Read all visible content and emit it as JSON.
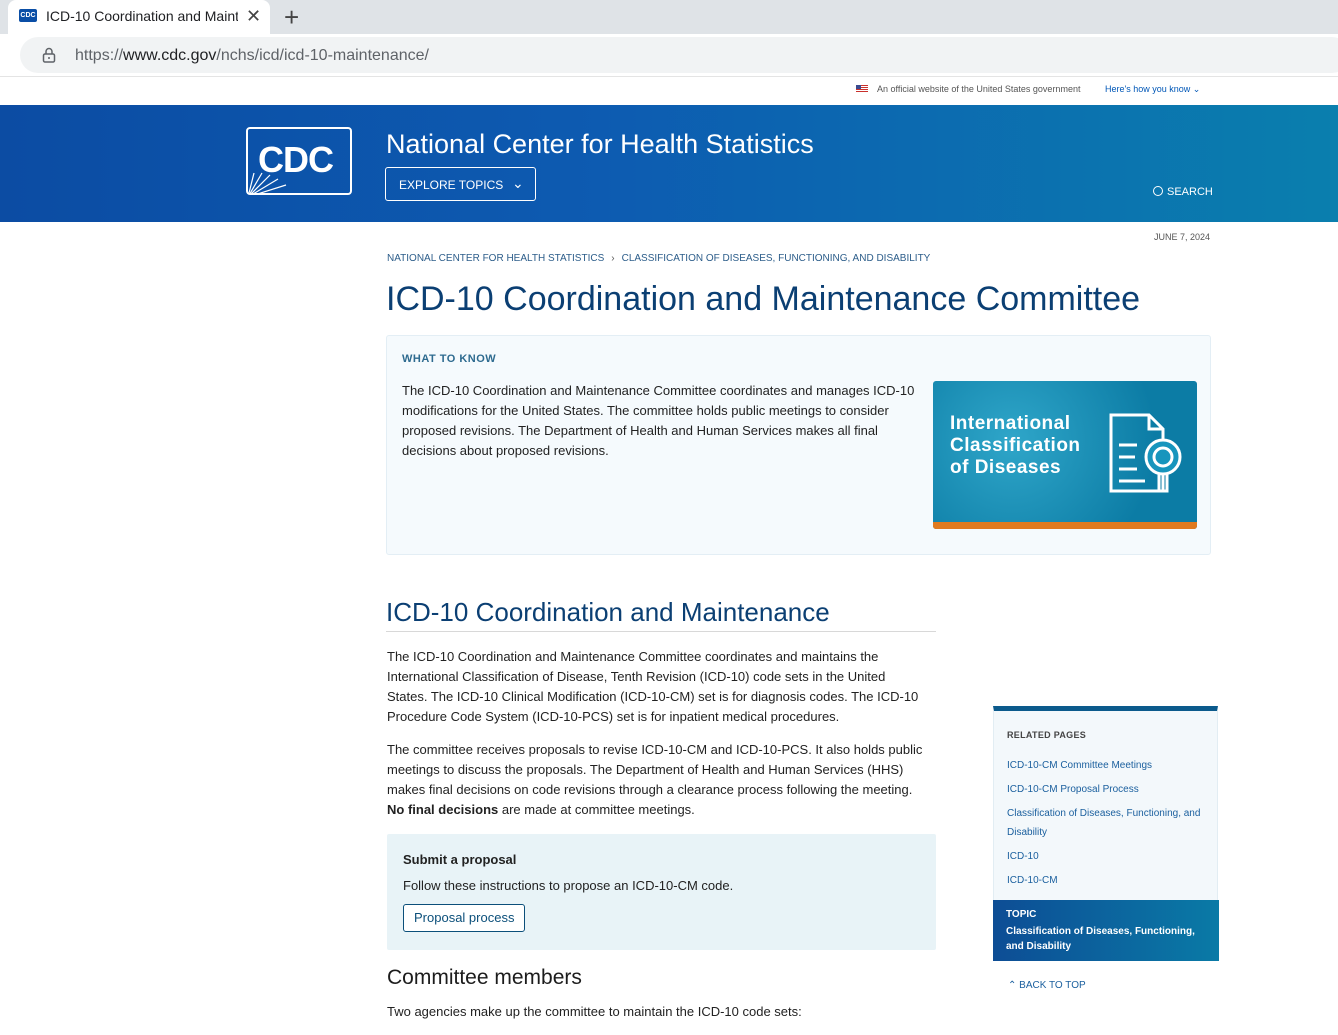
{
  "browser": {
    "tab_title": "ICD-10 Coordination and Mainte",
    "favicon_text": "CDC",
    "url_prefix": "https://",
    "url_host": "www.cdc.gov",
    "url_path": "/nchs/icd/icd-10-maintenance/"
  },
  "gov_banner": {
    "text": "An official website of the United States government",
    "link": "Here's how you know"
  },
  "header": {
    "logo_text": "CDC",
    "site_title": "National Center for Health Statistics",
    "explore_label": "EXPLORE TOPICS",
    "search_label": "SEARCH"
  },
  "page": {
    "date": "JUNE 7, 2024",
    "breadcrumb": [
      "NATIONAL CENTER FOR HEALTH STATISTICS",
      "CLASSIFICATION OF DISEASES, FUNCTIONING, AND DISABILITY"
    ],
    "title": "ICD-10 Coordination and Maintenance Committee"
  },
  "what_to_know": {
    "label": "WHAT TO KNOW",
    "text": "The ICD-10 Coordination and Maintenance Committee coordinates and manages ICD-10 modifications for the United States. The committee holds public meetings to consider proposed revisions. The Department of Health and Human Services makes all final decisions about proposed revisions.",
    "image_text": "International Classification of Diseases"
  },
  "section": {
    "heading": "ICD-10 Coordination and Maintenance",
    "para1": "The ICD-10 Coordination and Maintenance Committee coordinates and maintains the International Classification of Disease, Tenth Revision (ICD-10) code sets in the United States. The ICD-10 Clinical Modification (ICD-10-CM) set is for diagnosis codes. The ICD-10 Procedure Code System (ICD-10-PCS) set is for inpatient medical procedures.",
    "para2_start": "The committee receives proposals to revise ICD-10-CM and ICD-10-PCS. It also holds public meetings to discuss the proposals. The Department of Health and Human Services (HHS) makes final decisions on code revisions through a clearance process following the meeting. ",
    "para2_bold": "No final decisions",
    "para2_end": " are made at committee meetings."
  },
  "proposal": {
    "title": "Submit a proposal",
    "text": "Follow these instructions to propose an ICD-10-CM code.",
    "button": "Proposal process"
  },
  "members": {
    "heading": "Committee members",
    "text": "Two agencies make up the committee to maintain the ICD-10 code sets:"
  },
  "related": {
    "label": "RELATED PAGES",
    "items": [
      "ICD-10-CM Committee Meetings",
      "ICD-10-CM Proposal Process",
      "Classification of Diseases, Functioning, and Disability",
      "ICD-10",
      "ICD-10-CM"
    ],
    "topic_label": "TOPIC",
    "topic_name": "Classification of Diseases, Functioning, and Disability",
    "back_to_top": "BACK TO TOP"
  }
}
